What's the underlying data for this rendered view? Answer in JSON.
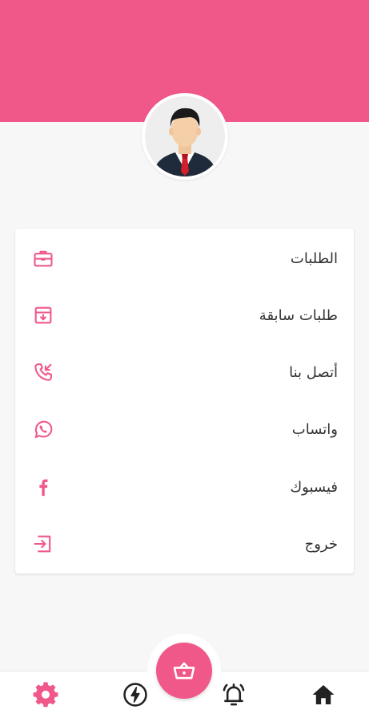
{
  "colors": {
    "accent": "#f0588a",
    "background": "#f7f7f7",
    "card": "#ffffff",
    "text": "#333333",
    "nav_icon": "#222222"
  },
  "profile": {
    "avatar_icon": "businessman-avatar-icon"
  },
  "menu": {
    "items": [
      {
        "label": "الطلبات",
        "icon": "briefcase-icon"
      },
      {
        "label": "طلبات سابقة",
        "icon": "archive-box-icon"
      },
      {
        "label": "أتصل بنا",
        "icon": "phone-incoming-icon"
      },
      {
        "label": "واتساب",
        "icon": "whatsapp-icon"
      },
      {
        "label": "فيسبوك",
        "icon": "facebook-icon"
      },
      {
        "label": "خروج",
        "icon": "logout-icon"
      }
    ]
  },
  "bottom_nav": {
    "items": [
      {
        "icon": "gear-icon",
        "active": true
      },
      {
        "icon": "lightning-icon",
        "active": false
      },
      {
        "icon": "bell-alarm-icon",
        "active": false
      },
      {
        "icon": "home-icon",
        "active": false
      }
    ],
    "fab_icon": "basket-icon"
  }
}
